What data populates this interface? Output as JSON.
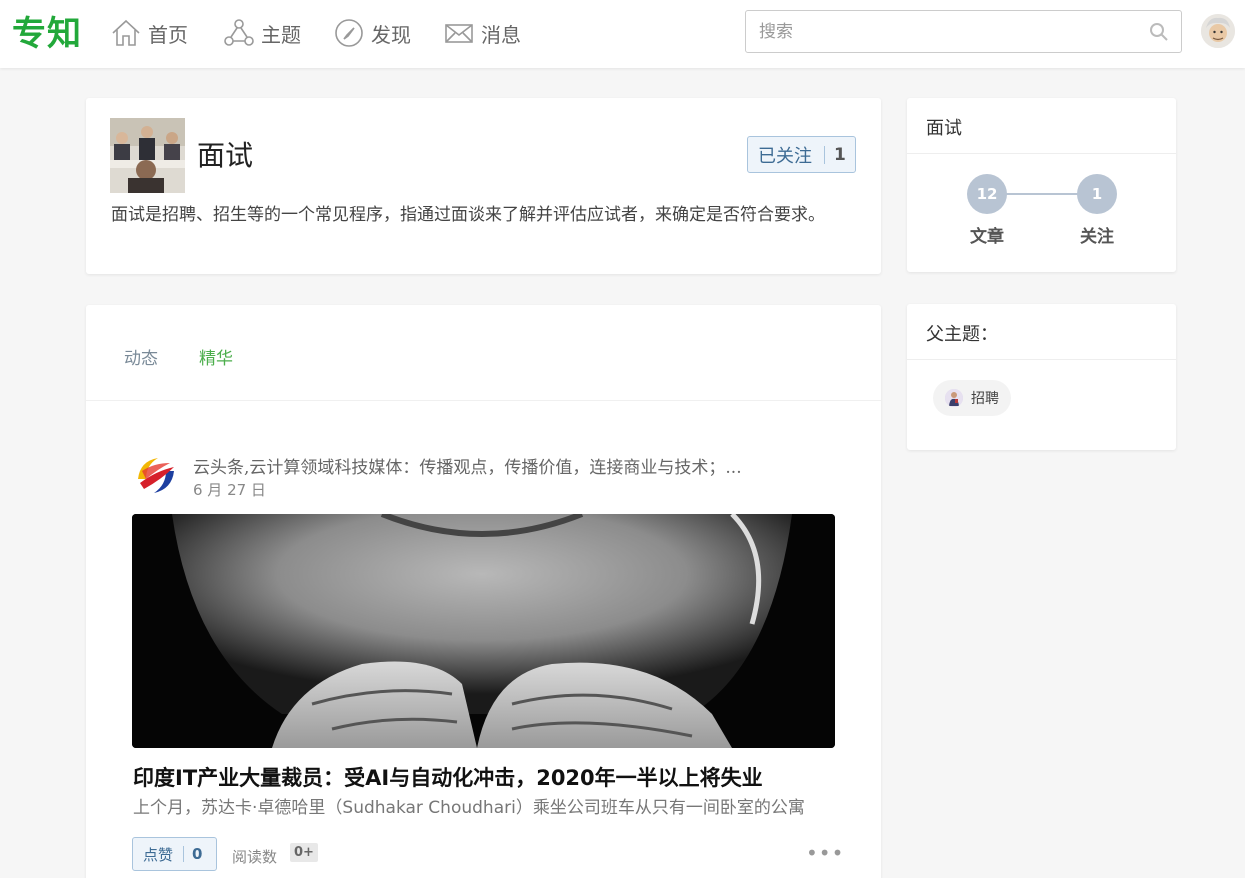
{
  "brand": {
    "logo": "专知"
  },
  "nav": [
    {
      "label": "首页",
      "icon": "home-icon"
    },
    {
      "label": "主题",
      "icon": "topics-icon"
    },
    {
      "label": "发现",
      "icon": "compass-icon"
    },
    {
      "label": "消息",
      "icon": "mail-icon"
    }
  ],
  "search": {
    "placeholder": "搜索",
    "icon": "search-icon"
  },
  "topic": {
    "title": "面试",
    "follow_label": "已关注",
    "follow_count": "1",
    "description": "面试是招聘、招生等的一个常见程序，指通过面谈来了解并评估应试者，来确定是否符合要求。"
  },
  "stats": {
    "header": "面试",
    "articles_count": "12",
    "articles_label": "文章",
    "followers_count": "1",
    "followers_label": "关注"
  },
  "parent": {
    "header": "父主题：",
    "tag_label": "招聘"
  },
  "tabs": [
    {
      "label": "动态",
      "active": false
    },
    {
      "label": "精华",
      "active": true
    }
  ],
  "post": {
    "author": "云头条,云计算领域科技媒体：传播观点，传播价值，连接商业与技术；...",
    "date": "6 月 27 日",
    "title": "印度IT产业大量裁员：受AI与自动化冲击，2020年一半以上将失业",
    "excerpt": "上个月，苏达卡·卓德哈里（Sudhakar Choudhari）乘坐公司班车从只有一间卧室的公寓",
    "like_label": "点赞",
    "like_count": "0",
    "reads_label": "阅读数",
    "reads_count": "0+",
    "more": "•••"
  },
  "colors": {
    "brand": "#22a83a",
    "active_tab": "#4cae4c",
    "accent_blue": "#3d6b94",
    "stat_bubble": "#b8c4d3"
  }
}
